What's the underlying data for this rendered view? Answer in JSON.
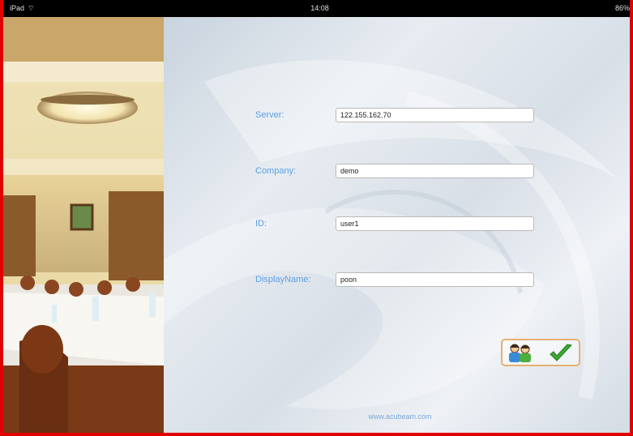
{
  "status_bar": {
    "device": "iPad",
    "time": "14:08",
    "battery": "86%"
  },
  "form": {
    "server_label": "Server:",
    "server_value": "122.155.162.70",
    "company_label": "Company:",
    "company_value": "demo",
    "id_label": "ID:",
    "id_value": "user1",
    "display_name_label": "DisplayName:",
    "display_name_value": "poon"
  },
  "actions": {
    "contacts_icon": "users-icon",
    "confirm_icon": "checkmark-icon"
  },
  "footer": {
    "link": "www.acubeam.com"
  },
  "colors": {
    "label": "#5aa0e8",
    "frame_border": "#e00000",
    "button_border": "#e8b070",
    "check": "#3aa832"
  }
}
